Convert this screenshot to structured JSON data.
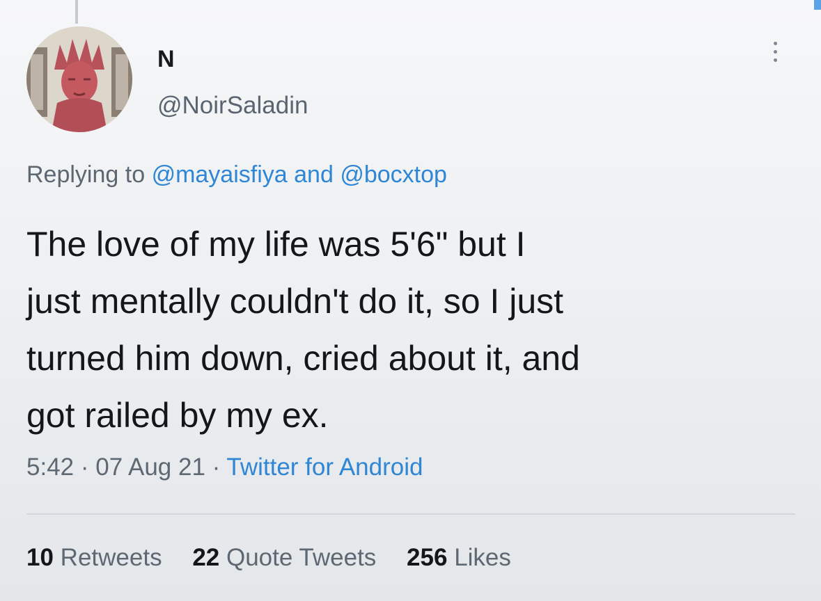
{
  "tweet": {
    "author": {
      "display_name": "N",
      "handle": "@NoirSaladin",
      "avatar_icon": "statue-of-liberty-art-avatar"
    },
    "more_icon": "more-options-icon",
    "replying": {
      "prefix": "Replying to",
      "mention_1": "@mayaisfiya",
      "connector": "and",
      "mention_2": "@bocxtop"
    },
    "text_lines": [
      "The love of my life was 5'6\" but I",
      "just mentally couldn't do it, so I just",
      "turned him down, cried about it, and",
      "got railed by my ex."
    ],
    "meta": {
      "time": "5:42",
      "date": "07 Aug 21",
      "separator": "·",
      "source": "Twitter for Android"
    },
    "stats": {
      "retweets_count": "10",
      "retweets_label": "Retweets",
      "quotes_count": "22",
      "quotes_label": "Quote Tweets",
      "likes_count": "256",
      "likes_label": "Likes"
    }
  },
  "colors": {
    "link": "#2f86d4",
    "secondary_text": "#5e6873",
    "primary_text": "#141619"
  }
}
